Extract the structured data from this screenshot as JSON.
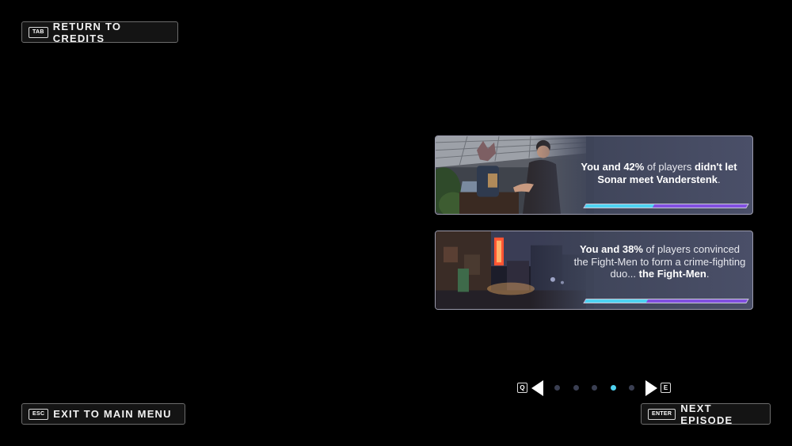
{
  "top_button": {
    "key": "TAB",
    "label": "RETURN TO CREDITS"
  },
  "cards": [
    {
      "parts": [
        {
          "text": "You and 42%",
          "bold": true
        },
        {
          "text": " of players ",
          "bold": false
        },
        {
          "text": "didn't let Sonar meet Vanderstenk",
          "bold": true
        },
        {
          "text": ".",
          "bold": false
        }
      ],
      "percent": 42
    },
    {
      "parts": [
        {
          "text": "You and 38%",
          "bold": true
        },
        {
          "text": " of players convinced the Fight-Men to form a crime-fighting duo... ",
          "bold": false
        },
        {
          "text": "the Fight-Men",
          "bold": true
        },
        {
          "text": ".",
          "bold": false
        }
      ],
      "percent": 38
    }
  ],
  "pager": {
    "prev_key": "Q",
    "next_key": "E",
    "pages": 5,
    "active_page": 4
  },
  "bottom_left_button": {
    "key": "ESC",
    "label": "EXIT TO MAIN MENU"
  },
  "bottom_right_button": {
    "key": "ENTER",
    "label": "NEXT EPISODE"
  },
  "colors": {
    "bar_player": "#4ed3f2",
    "bar_other": "#8150e0",
    "active_dot": "#4fd2f0"
  }
}
